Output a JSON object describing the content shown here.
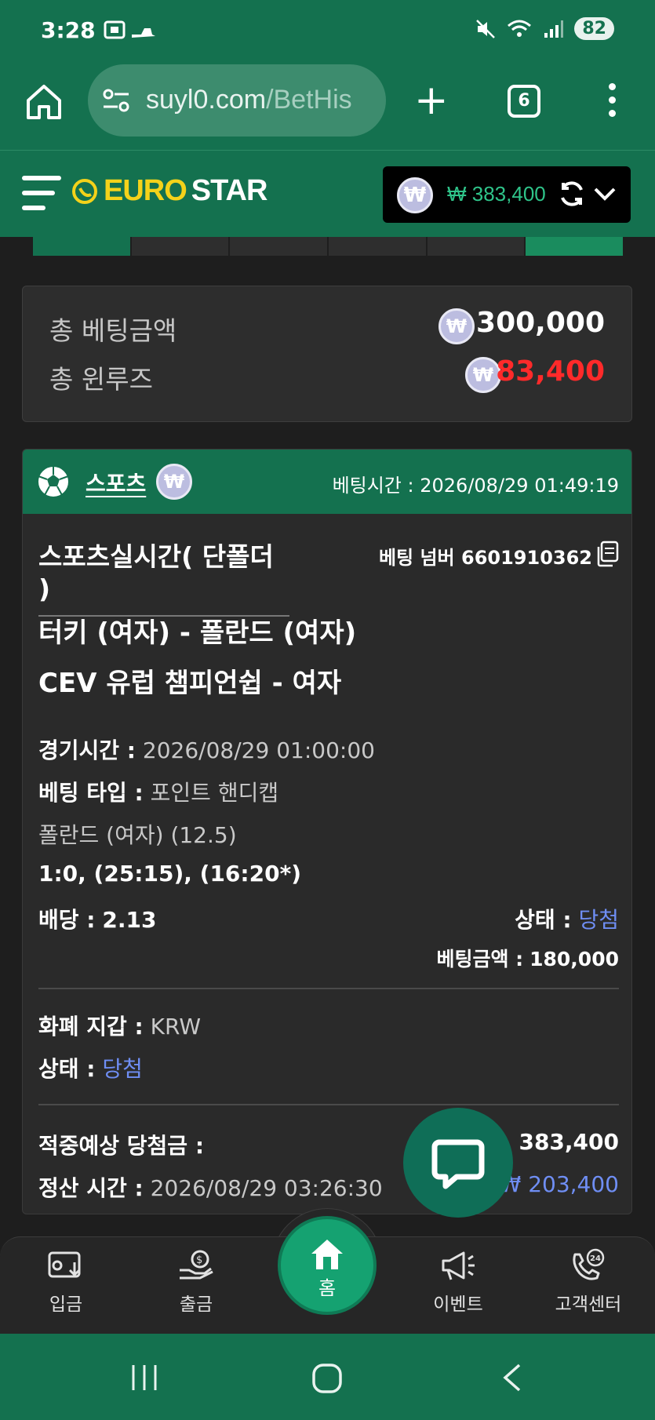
{
  "status_bar": {
    "time": "3:28",
    "battery": "82"
  },
  "browser": {
    "url": "suyl0.com",
    "url_path": "/BetHis",
    "tab_count": "6"
  },
  "header": {
    "logo_part1": "EURO",
    "logo_part2": "STAR",
    "balance": "₩ 383,400",
    "currency_symbol": "₩"
  },
  "summary": {
    "total_bet_label": "총 베팅금액",
    "total_bet_value": "300,000",
    "total_winloss_label": "총 윈루즈",
    "total_winloss_value": "83,400"
  },
  "bet": {
    "category": "스포츠",
    "time_label": "베팅시간 :",
    "time_value": "2026/08/29 01:49:19",
    "title": "스포츠실시간( 단폴더 )",
    "number_label": "베팅 넘버",
    "number_value": "6601910362",
    "match_line1": "터키 (여자) - 폴란드 (여자)",
    "match_line2": "CEV 유럽 챔피언쉽 - 여자",
    "game_time_label": "경기시간 :",
    "game_time_value": "2026/08/29 01:00:00",
    "bet_type_label": "베팅 타입 :",
    "bet_type_value": "포인트 핸디캡",
    "selection": "폴란드 (여자) (12.5)",
    "score": "1:0, (25:15), (16:20*)",
    "odds_label": "배당 :",
    "odds_value": "2.13",
    "status_label": "상태 :",
    "status_value": "당첨",
    "bet_amount_label": "베팅금액 :",
    "bet_amount_value": "180,000",
    "wallet_label": "화폐 지갑 :",
    "wallet_value": "KRW",
    "status2_label": "상태 :",
    "status2_value": "당첨",
    "expected_win_label": "적중예상 당첨금 :",
    "expected_win_value": "383,400",
    "settle_label": "정산 시간 :",
    "settle_value": "2026/08/29 03:26:30",
    "profit_value": "₩ 203,400"
  },
  "bottom_nav": {
    "deposit": "입금",
    "withdraw": "출금",
    "home": "홈",
    "event": "이벤트",
    "support": "고객센터"
  },
  "colors": {
    "brand_green": "#14714f",
    "loss_red": "#ff2a2a",
    "status_blue": "#6f8ef4",
    "balance_green": "#2fc48a"
  }
}
